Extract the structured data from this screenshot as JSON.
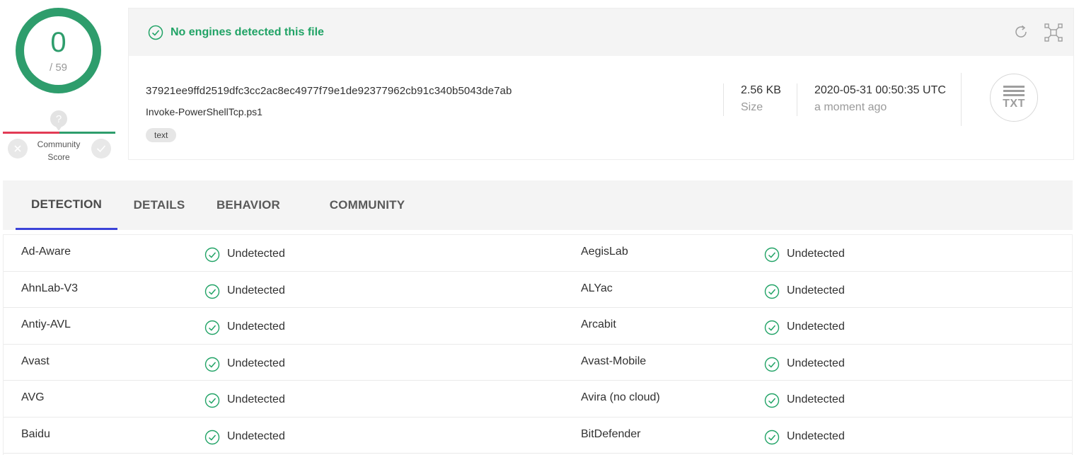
{
  "score": {
    "detected": "0",
    "total": "/ 59",
    "colors": {
      "ring": "#2e9d6c",
      "negative": "#e23b55",
      "positive": "#2e9d6c"
    }
  },
  "community": {
    "question_mark": "?",
    "label_line1": "Community",
    "label_line2": "Score",
    "vote_down_icon": "x-icon",
    "vote_up_icon": "check-icon"
  },
  "status": {
    "message": "No engines detected this file",
    "icon": "check-circle-icon",
    "color": "#21a366"
  },
  "toolbar": {
    "reanalyze_icon": "refresh-icon",
    "graph_icon": "graph-icon"
  },
  "file": {
    "hash": "37921ee9ffd2519dfc3cc2ac8ec4977f79e1de92377962cb91c340b5043de7ab",
    "name": "Invoke-PowerShellTcp.ps1",
    "tag": "text",
    "size": "2.56 KB",
    "size_label": "Size",
    "date": "2020-05-31 00:50:35 UTC",
    "date_relative": "a moment ago",
    "type": "TXT"
  },
  "tabs": [
    {
      "label": "DETECTION",
      "active": true
    },
    {
      "label": "DETAILS",
      "active": false
    },
    {
      "label": "BEHAVIOR",
      "active": false
    },
    {
      "label": "COMMUNITY",
      "active": false
    }
  ],
  "detections": [
    {
      "left_engine": "Ad-Aware",
      "left_result": "Undetected",
      "right_engine": "AegisLab",
      "right_result": "Undetected"
    },
    {
      "left_engine": "AhnLab-V3",
      "left_result": "Undetected",
      "right_engine": "ALYac",
      "right_result": "Undetected"
    },
    {
      "left_engine": "Antiy-AVL",
      "left_result": "Undetected",
      "right_engine": "Arcabit",
      "right_result": "Undetected"
    },
    {
      "left_engine": "Avast",
      "left_result": "Undetected",
      "right_engine": "Avast-Mobile",
      "right_result": "Undetected"
    },
    {
      "left_engine": "AVG",
      "left_result": "Undetected",
      "right_engine": "Avira (no cloud)",
      "right_result": "Undetected"
    },
    {
      "left_engine": "Baidu",
      "left_result": "Undetected",
      "right_engine": "BitDefender",
      "right_result": "Undetected"
    }
  ]
}
